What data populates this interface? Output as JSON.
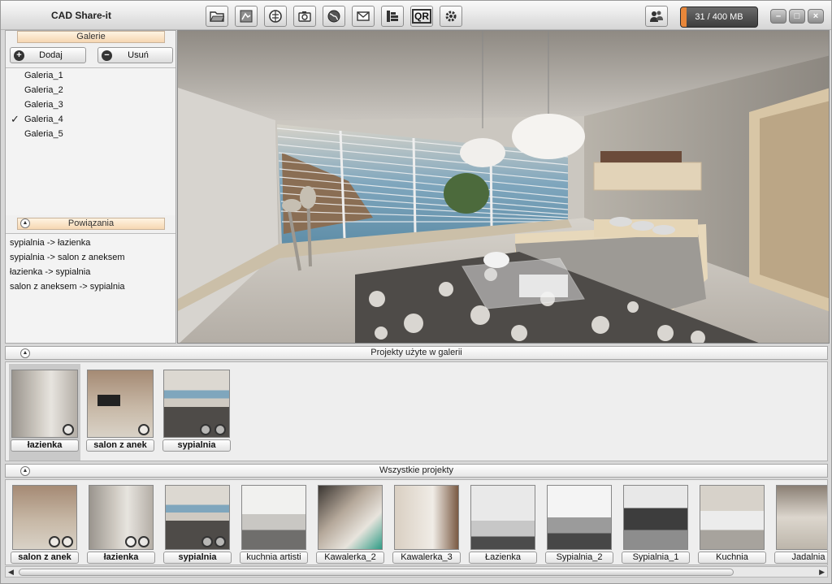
{
  "app": {
    "title": "CAD Share-it"
  },
  "toolbar": {
    "buttons": [
      {
        "icon": "folder-open-icon"
      },
      {
        "icon": "drawing-icon"
      },
      {
        "icon": "world-pin-icon"
      },
      {
        "icon": "camera-icon"
      },
      {
        "icon": "globe-icon"
      },
      {
        "icon": "mail-icon"
      },
      {
        "icon": "organizer-icon"
      },
      {
        "icon": "qr-icon",
        "label": "QR"
      },
      {
        "icon": "gear-icon"
      }
    ]
  },
  "storage": {
    "text": "31 / 400 MB",
    "fraction": 0.0775
  },
  "galleries": {
    "header": "Galerie",
    "add_label": "Dodaj",
    "remove_label": "Usuń",
    "items": [
      "Galeria_1",
      "Galeria_2",
      "Galeria_3",
      "Galeria_4",
      "Galeria_5"
    ],
    "checked": "Galeria_4"
  },
  "relations": {
    "header": "Powiązania",
    "items": [
      "sypialnia -> łazienka",
      "sypialnia -> salon z aneksem",
      "łazienka -> sypialnia",
      "salon z aneksem -> sypialnia"
    ]
  },
  "used_projects": {
    "header": "Projekty użyte w galerii",
    "items": [
      "łazienka",
      "salon z anek",
      "sypialnia"
    ]
  },
  "all_projects": {
    "header": "Wszystkie projekty",
    "items": [
      "salon z anek",
      "łazienka",
      "sypialnia",
      "kuchnia artisti",
      "Kawalerka_2",
      "Kawalerka_3",
      "Łazienka",
      "Sypialnia_2",
      "Sypialnia_1",
      "Kuchnia",
      "Jadalnia"
    ]
  },
  "colors": {
    "accent": "#e8873a",
    "header_bg": "#f6d7b2"
  }
}
